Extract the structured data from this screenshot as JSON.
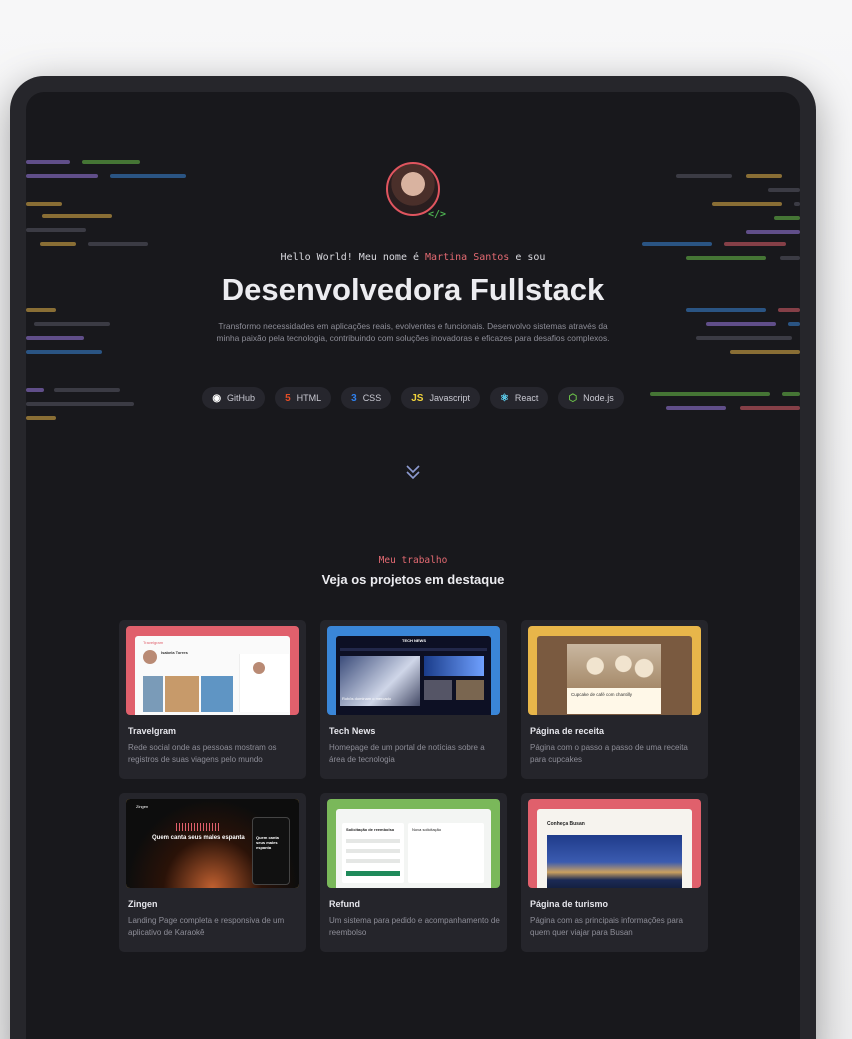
{
  "hero": {
    "greeting_prefix": "Hello World! Meu nome é ",
    "greeting_name": "Martina Santos",
    "greeting_suffix": " e sou",
    "headline": "Desenvolvedora Fullstack",
    "intro": "Transformo necessidades em aplicações reais, evolventes e funcionais. Desenvolvo sistemas através da minha paixão pela tecnologia, contribuindo com soluções inovadoras e eficazes para desafios complexos.",
    "avatar_badge": "</>",
    "skills": [
      {
        "label": "GitHub",
        "icon": "github-icon",
        "glyph": "◉",
        "color": "#ffffff"
      },
      {
        "label": "HTML",
        "icon": "html5-icon",
        "glyph": "5",
        "color": "#e44d26"
      },
      {
        "label": "CSS",
        "icon": "css3-icon",
        "glyph": "3",
        "color": "#2f80ed"
      },
      {
        "label": "Javascript",
        "icon": "javascript-icon",
        "glyph": "JS",
        "color": "#f0d33b"
      },
      {
        "label": "React",
        "icon": "react-icon",
        "glyph": "⚛",
        "color": "#61dafb"
      },
      {
        "label": "Node.js",
        "icon": "nodejs-icon",
        "glyph": "⬡",
        "color": "#6cc24a"
      }
    ],
    "scroll_icon": "chevron-double-down-icon"
  },
  "work": {
    "eyebrow": "Meu trabalho",
    "title": "Veja os projetos em destaque",
    "projects": [
      {
        "title": "Travelgram",
        "description": "Rede social onde as pessoas mostram os registros de suas viagens pelo mundo",
        "thumb_bg": "#e0606c",
        "thumb_texts": [
          "Travelgram",
          "Isabela Torres"
        ]
      },
      {
        "title": "Tech News",
        "description": "Homepage de um portal de notícias sobre a área de tecnologia",
        "thumb_bg": "#3a86d8",
        "thumb_texts": [
          "TECH NEWS",
          "Robôs dominam o mercado"
        ]
      },
      {
        "title": "Página de receita",
        "description": "Página com o passo a passo de uma receita para cupcakes",
        "thumb_bg": "#e8b64a",
        "thumb_texts": [
          "Cupcake de café com chantilly"
        ]
      },
      {
        "title": "Zingen",
        "description": "Landing Page completa e responsiva de um aplicativo de Karaokê",
        "thumb_bg": "#e8b64a",
        "thumb_texts": [
          "Zingen",
          "Quem canta seus males espanta",
          "Quem canta seus males espanta"
        ]
      },
      {
        "title": "Refund",
        "description": "Um sistema para pedido e acompanhamento de reembolso",
        "thumb_bg": "#7ab85a",
        "thumb_texts": [
          "Solicitação de reembolso",
          "Nova solicitação"
        ]
      },
      {
        "title": "Página de turismo",
        "description": "Página com as principais informações para quem quer viajar para Busan",
        "thumb_bg": "#e0606c",
        "thumb_texts": [
          "Conheça Busan"
        ]
      }
    ]
  }
}
